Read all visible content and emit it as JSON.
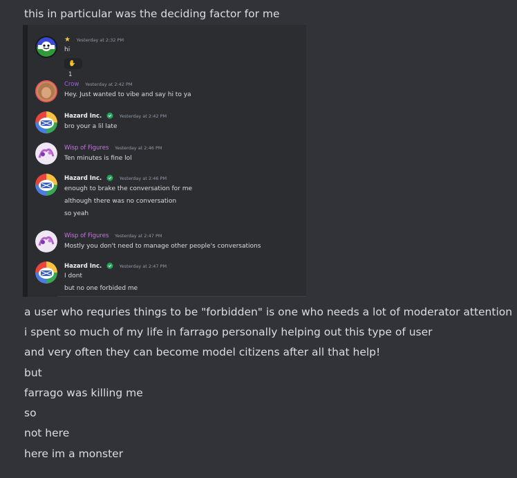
{
  "top_text": "this in particular was the deciding factor for me",
  "embed": {
    "messages": [
      {
        "username": "",
        "timestamp": "Yesterday at 2:32 PM",
        "lines": [
          "hi"
        ],
        "reaction": {
          "emoji": "wave-icon",
          "count": "1"
        }
      },
      {
        "username": "Crow",
        "timestamp": "Yesterday at 2:42 PM",
        "lines": [
          "Hey. Just wanted to vibe and say hi to ya"
        ]
      },
      {
        "username": "Hazard Inc.",
        "timestamp": "Yesterday at 2:42 PM",
        "lines": [
          "bro your a lil late"
        ]
      },
      {
        "username": "Wisp of Figures",
        "timestamp": "Yesterday at 2:46 PM",
        "lines": [
          "Ten minutes is fine lol"
        ]
      },
      {
        "username": "Hazard Inc.",
        "timestamp": "Yesterday at 2:46 PM",
        "lines": [
          "enough to brake the conversation for me",
          "although there was no conversation",
          "so yeah"
        ]
      },
      {
        "username": "Wisp of Figures",
        "timestamp": "Yesterday at 2:47 PM",
        "lines": [
          "Mostly you don't need to manage other people's conversations"
        ]
      },
      {
        "username": "Hazard Inc.",
        "timestamp": "Yesterday at 2:47 PM",
        "lines": [
          "I dont",
          "but no one forbided me"
        ]
      }
    ]
  },
  "bottom_lines": [
    "a user who requries things to be \"forbidden\" is one who needs a lot of moderator attention",
    "i spent so much of my life in farrago personally helping out this type of user",
    "and very often they can become model citizens after all that help!",
    "but",
    "farrago was killing me",
    "so",
    "not here",
    "here im a monster"
  ],
  "colors": {
    "background": "#313338",
    "embed_background": "#2b2d31",
    "text": "#dbdee1",
    "timestamp": "#949ba4",
    "crow_name": "#a363e0",
    "wisp_name": "#c27cd8",
    "verified_badge": "#23a55a"
  }
}
